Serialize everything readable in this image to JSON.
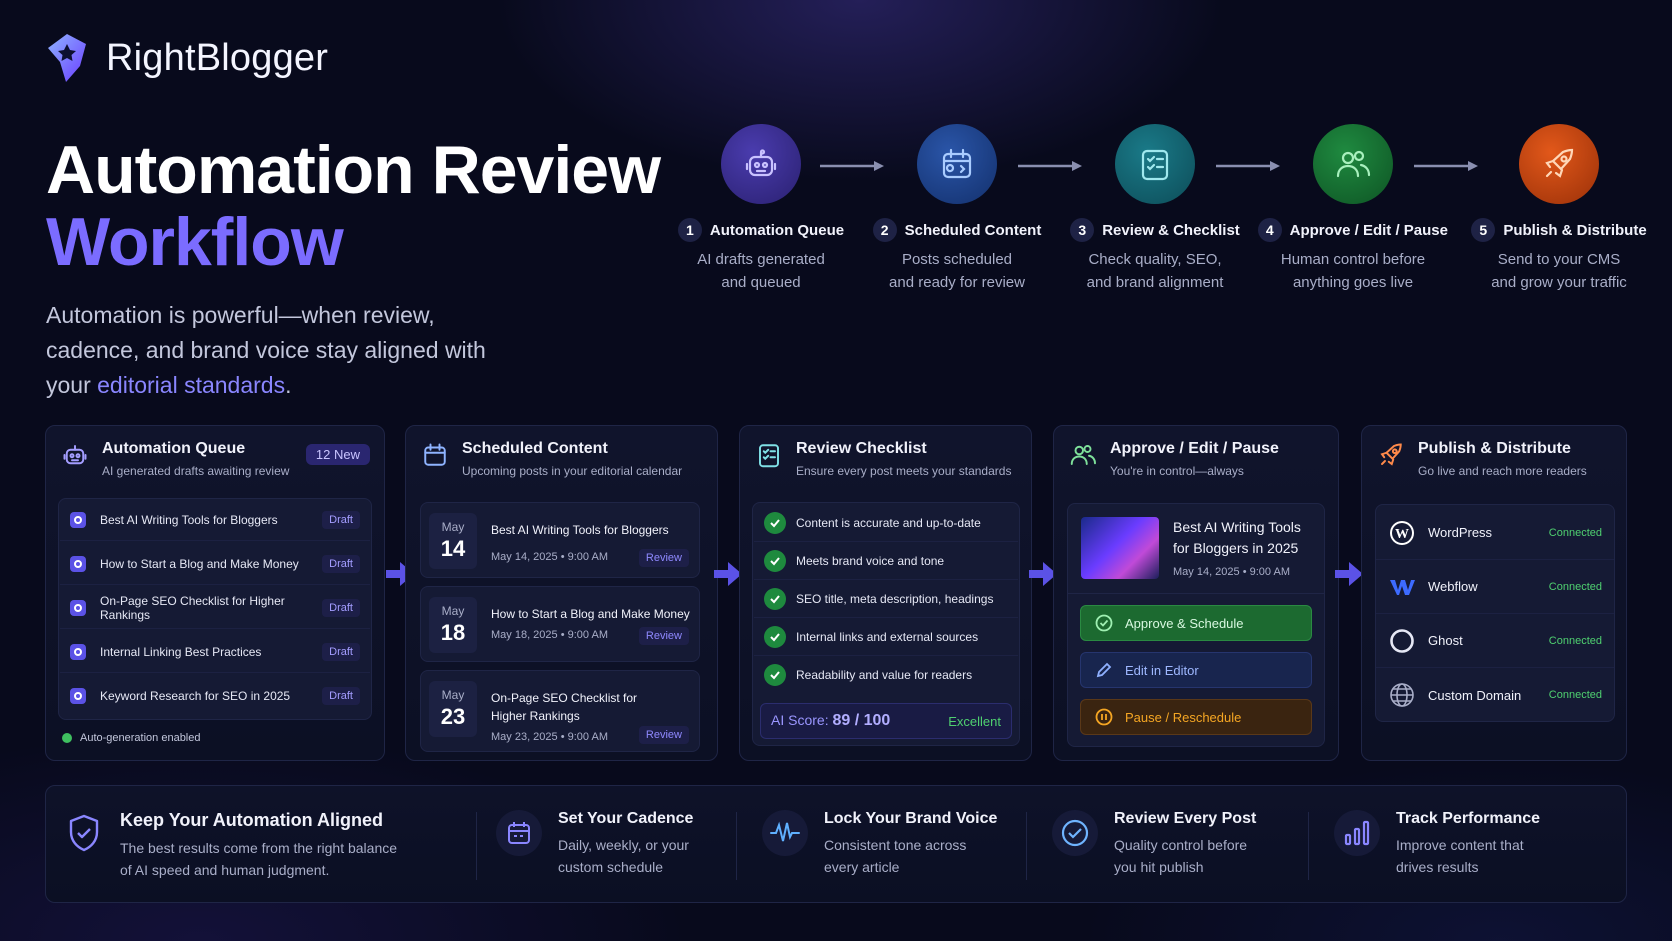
{
  "brand": {
    "name": "RightBlogger"
  },
  "hero": {
    "title_line1": "Automation Review",
    "title_line2": "Workflow",
    "sub_part1": "Automation is powerful—when review, cadence, and brand voice stay aligned with your ",
    "sub_highlight": "editorial standards",
    "sub_part2": "."
  },
  "steps": [
    {
      "num": "1",
      "label": "Automation Queue",
      "desc1": "AI drafts generated",
      "desc2": "and queued",
      "color": "#3a2e8a",
      "icon": "robot-icon"
    },
    {
      "num": "2",
      "label": "Scheduled Content",
      "desc1": "Posts scheduled",
      "desc2": "and ready for review",
      "color": "#1c3a7a",
      "icon": "calendar-icon"
    },
    {
      "num": "3",
      "label": "Review & Checklist",
      "desc1": "Check quality, SEO,",
      "desc2": "and brand alignment",
      "color": "#0f5a6a",
      "icon": "checklist-icon"
    },
    {
      "num": "4",
      "label": "Approve / Edit / Pause",
      "desc1": "Human control before",
      "desc2": "anything goes live",
      "color": "#15602e",
      "icon": "users-icon"
    },
    {
      "num": "5",
      "label": "Publish & Distribute",
      "desc1": "Send to your CMS",
      "desc2": "and grow your traffic",
      "color": "#b2400e",
      "icon": "rocket-icon"
    }
  ],
  "queue": {
    "title": "Automation Queue",
    "subtitle": "AI generated drafts awaiting review",
    "badge": "12 New",
    "items": [
      {
        "title": "Best AI Writing Tools for Bloggers",
        "status": "Draft"
      },
      {
        "title": "How to Start a Blog and Make Money",
        "status": "Draft"
      },
      {
        "title": "On-Page SEO Checklist for Higher Rankings",
        "status": "Draft"
      },
      {
        "title": "Internal Linking Best Practices",
        "status": "Draft"
      },
      {
        "title": "Keyword Research for SEO in 2025",
        "status": "Draft"
      }
    ],
    "footer": "Auto-generation enabled"
  },
  "scheduled": {
    "title": "Scheduled Content",
    "subtitle": "Upcoming posts in your editorial calendar",
    "items": [
      {
        "month": "May",
        "day": "14",
        "title": "Best AI Writing Tools for Bloggers",
        "meta": "May 14, 2025 • 9:00 AM",
        "status": "Review"
      },
      {
        "month": "May",
        "day": "18",
        "title": "How to Start a Blog and Make Money",
        "meta": "May 18, 2025 • 9:00 AM",
        "status": "Review"
      },
      {
        "month": "May",
        "day": "23",
        "title": "On-Page SEO Checklist for Higher Rankings",
        "meta": "May 23, 2025 • 9:00 AM",
        "status": "Review"
      }
    ]
  },
  "checklist": {
    "title": "Review Checklist",
    "subtitle": "Ensure every post meets your standards",
    "items": [
      "Content is accurate and up-to-date",
      "Meets brand voice and tone",
      "SEO title, meta description, headings",
      "Internal links and external sources",
      "Readability and value for readers"
    ],
    "score_label": "AI Score:",
    "score_value": "89 / 100",
    "score_rating": "Excellent"
  },
  "approve": {
    "title": "Approve / Edit / Pause",
    "subtitle": "You're in control—always",
    "post_title": "Best AI Writing Tools for Bloggers in 2025",
    "post_meta": "May 14, 2025 • 9:00 AM",
    "btn_approve": "Approve & Schedule",
    "btn_edit": "Edit in Editor",
    "btn_pause": "Pause / Reschedule"
  },
  "publish": {
    "title": "Publish & Distribute",
    "subtitle": "Go live and reach more readers",
    "items": [
      {
        "name": "WordPress",
        "status": "Connected",
        "icon": "wordpress-icon"
      },
      {
        "name": "Webflow",
        "status": "Connected",
        "icon": "webflow-icon"
      },
      {
        "name": "Ghost",
        "status": "Connected",
        "icon": "ghost-icon"
      },
      {
        "name": "Custom Domain",
        "status": "Connected",
        "icon": "globe-icon"
      }
    ]
  },
  "bottom": [
    {
      "title": "Keep Your Automation Aligned",
      "desc1": "The best results come from the right balance",
      "desc2": "of AI speed and human judgment.",
      "icon": "shield-check-icon"
    },
    {
      "title": "Set Your Cadence",
      "desc1": "Daily, weekly, or your",
      "desc2": "custom schedule",
      "icon": "calendar-icon"
    },
    {
      "title": "Lock Your Brand Voice",
      "desc1": "Consistent tone across",
      "desc2": "every article",
      "icon": "waveform-icon"
    },
    {
      "title": "Review Every Post",
      "desc1": "Quality control before",
      "desc2": "you hit publish",
      "icon": "check-circle-icon"
    },
    {
      "title": "Track Performance",
      "desc1": "Improve content that",
      "desc2": "drives results",
      "icon": "bar-chart-icon"
    }
  ],
  "colors": {
    "accent": "#7b6cff",
    "success": "#4fd070",
    "warning": "#f5a623",
    "background": "#080a1c"
  }
}
